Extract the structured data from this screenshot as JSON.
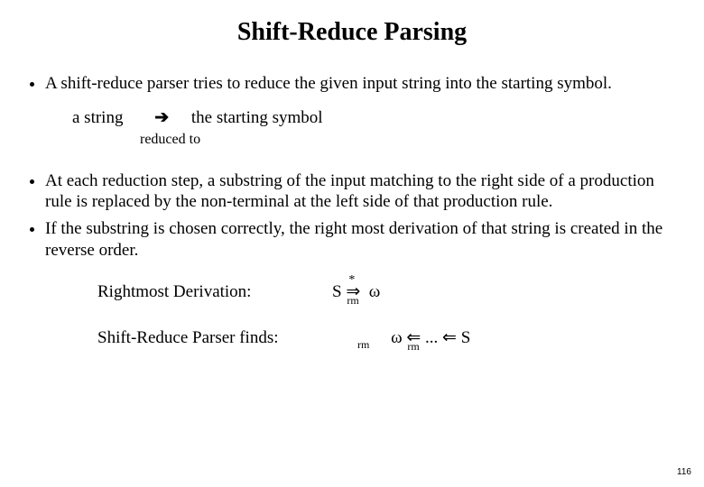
{
  "title": "Shift-Reduce Parsing",
  "bullets": {
    "b1": "A shift-reduce parser tries to reduce the given input string into the starting symbol.",
    "b2": "At each reduction step, a substring of the input matching to the right side of a production rule is replaced by the non-terminal at the left side of that production rule.",
    "b3": "If the substring is chosen correctly, the right most derivation of that string is created in the reverse order."
  },
  "row1": {
    "left": "a string",
    "arrow": "➔",
    "right": "the starting symbol",
    "caption": "reduced to"
  },
  "derivations": {
    "label1": "Rightmost Derivation:",
    "label2": "Shift-Reduce Parser finds:",
    "formula1": {
      "S": "S",
      "arrow": "⇒",
      "star": "*",
      "rm": "rm",
      "omega": "ω"
    },
    "formula2": {
      "rm1": "rm",
      "omega": "ω",
      "arrow": "⇐",
      "rm2": "rm",
      "dots": " ... ",
      "S": "S"
    }
  },
  "page_number": "116"
}
